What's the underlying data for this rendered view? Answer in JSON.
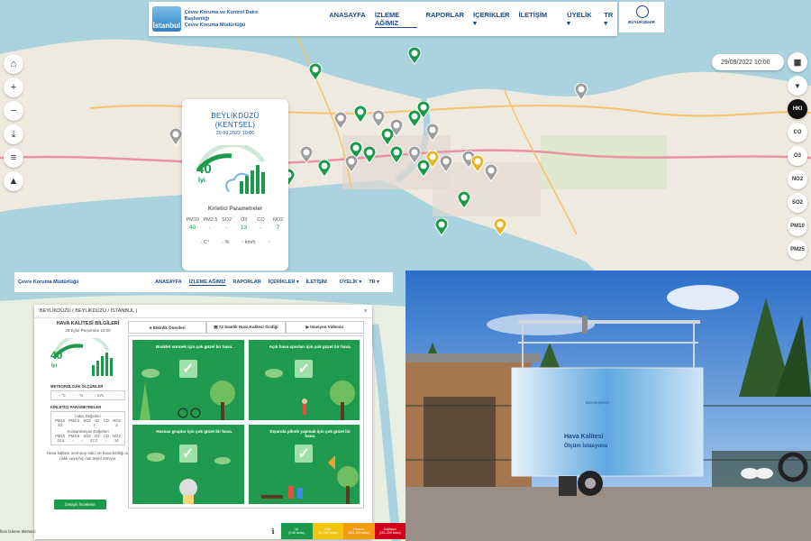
{
  "nav": {
    "logo_lines": [
      "Çevre Koruma ve Kontrol Daire Başkanlığı",
      "Çevre Koruma Müdürlüğü"
    ],
    "logo_name": "İstanbul",
    "links": [
      "ANASAYFA",
      "İZLEME AĞIMIZ",
      "RAPORLAR",
      "İÇERİKLER ▾",
      "İLETİŞİM"
    ],
    "right": [
      "ÜYELİK ▾",
      "TR ▾"
    ],
    "ibb": "BÜYÜKŞEHİR"
  },
  "map_controls": {
    "left_icons": [
      "home-icon",
      "zoom-in-icon",
      "zoom-out-icon",
      "download-icon",
      "list-icon",
      "road-icon"
    ],
    "left_glyphs": [
      "⌂",
      "+",
      "−",
      "⤓",
      "≡",
      "▲"
    ],
    "date": "29/09/2022 10:00",
    "calendar": "▦",
    "filter": "▼",
    "pollutants": [
      "HKI",
      "CO",
      "O3",
      "NO2",
      "SO2",
      "PM10",
      "PM25"
    ]
  },
  "station_card": {
    "name": "BEYLİKDÜZÜ",
    "type": "(KENTSEL)",
    "date": "29.09.2022 10:00",
    "aqi": "40",
    "aqi_label": "İyi",
    "params_title": "Kirletici Parametreler",
    "params": [
      {
        "name": "PM10",
        "value": "40"
      },
      {
        "name": "PM2.5",
        "value": "-"
      },
      {
        "name": "SO2",
        "value": "-"
      },
      {
        "name": "O3",
        "value": "13"
      },
      {
        "name": "CO",
        "value": "-"
      },
      {
        "name": "NO2",
        "value": "7"
      }
    ],
    "meteo": [
      "- C°",
      "- %",
      "- km/h",
      "-"
    ],
    "accent": "#1a9a4a"
  },
  "modal": {
    "header": "BEYLİKDÜZÜ ( BEYLİKDÜZÜ / İSTANBUL )",
    "close": "x",
    "title": "HAVA KALİTESİ BİLGİLERİ",
    "date": "29 Eylül Perşembe 10:00",
    "aqi": "40",
    "aqi_label": "İyi",
    "meteo_title": "METEOROLOJİK ÖLÇÜMLER",
    "meteo": [
      "- °C",
      "- %",
      "- m/s",
      "-"
    ],
    "kp_title": "KİRLETİCİ PARAMETRELER",
    "index_title": "İndex Değerleri",
    "index_headers": [
      "PM10",
      "PM2.5",
      "SO2",
      "O3",
      "CO",
      "NO2"
    ],
    "index_values": [
      "40",
      "-",
      "-",
      "7",
      "-",
      "4"
    ],
    "conc_title": "Konsantrasyon Değerleri",
    "conc_values": [
      "42.6",
      "-",
      "-",
      "27.2",
      "-",
      "14"
    ],
    "note": "Hava kalitesi memnun edici ve hava kirliliği az riskli veya hiç risk teşkil etmiyor",
    "detail_button": "Detaylı İnceleme",
    "tabs": [
      "♣ Etkinlik Önerileri",
      "▤ 72 Saatlik Hava Kalitesi Grafiği",
      "▶ İstasyon Videosu"
    ],
    "tiles": [
      "Bisiklet sürmek için çok güzel bir hava.",
      "Açık hava sporları için çok güzel bir hava.",
      "Hassas gruplar için çok güzel bir hava.",
      "Dışarıda piknik yapmak için çok güzel bir hava."
    ],
    "check": "✓"
  },
  "legend": [
    {
      "label": "İyi",
      "range": "(0-50 arası)",
      "color": "#1a9a4a"
    },
    {
      "label": "Orta",
      "range": "(51-100 arası)",
      "color": "#f1c40f"
    },
    {
      "label": "Hassas",
      "range": "(101-150 arası)",
      "color": "#f39c12"
    },
    {
      "label": "Sağlıksız",
      "range": "(151-200 arası)",
      "color": "#d0021b"
    }
  ],
  "footer": "İlesi İzleme Merkezi",
  "trailer": {
    "sign_line1": "Hava Kalitesi",
    "sign_line2": "Ölçüm İstasyonu",
    "brand": "BÜYÜKŞEHİR"
  }
}
